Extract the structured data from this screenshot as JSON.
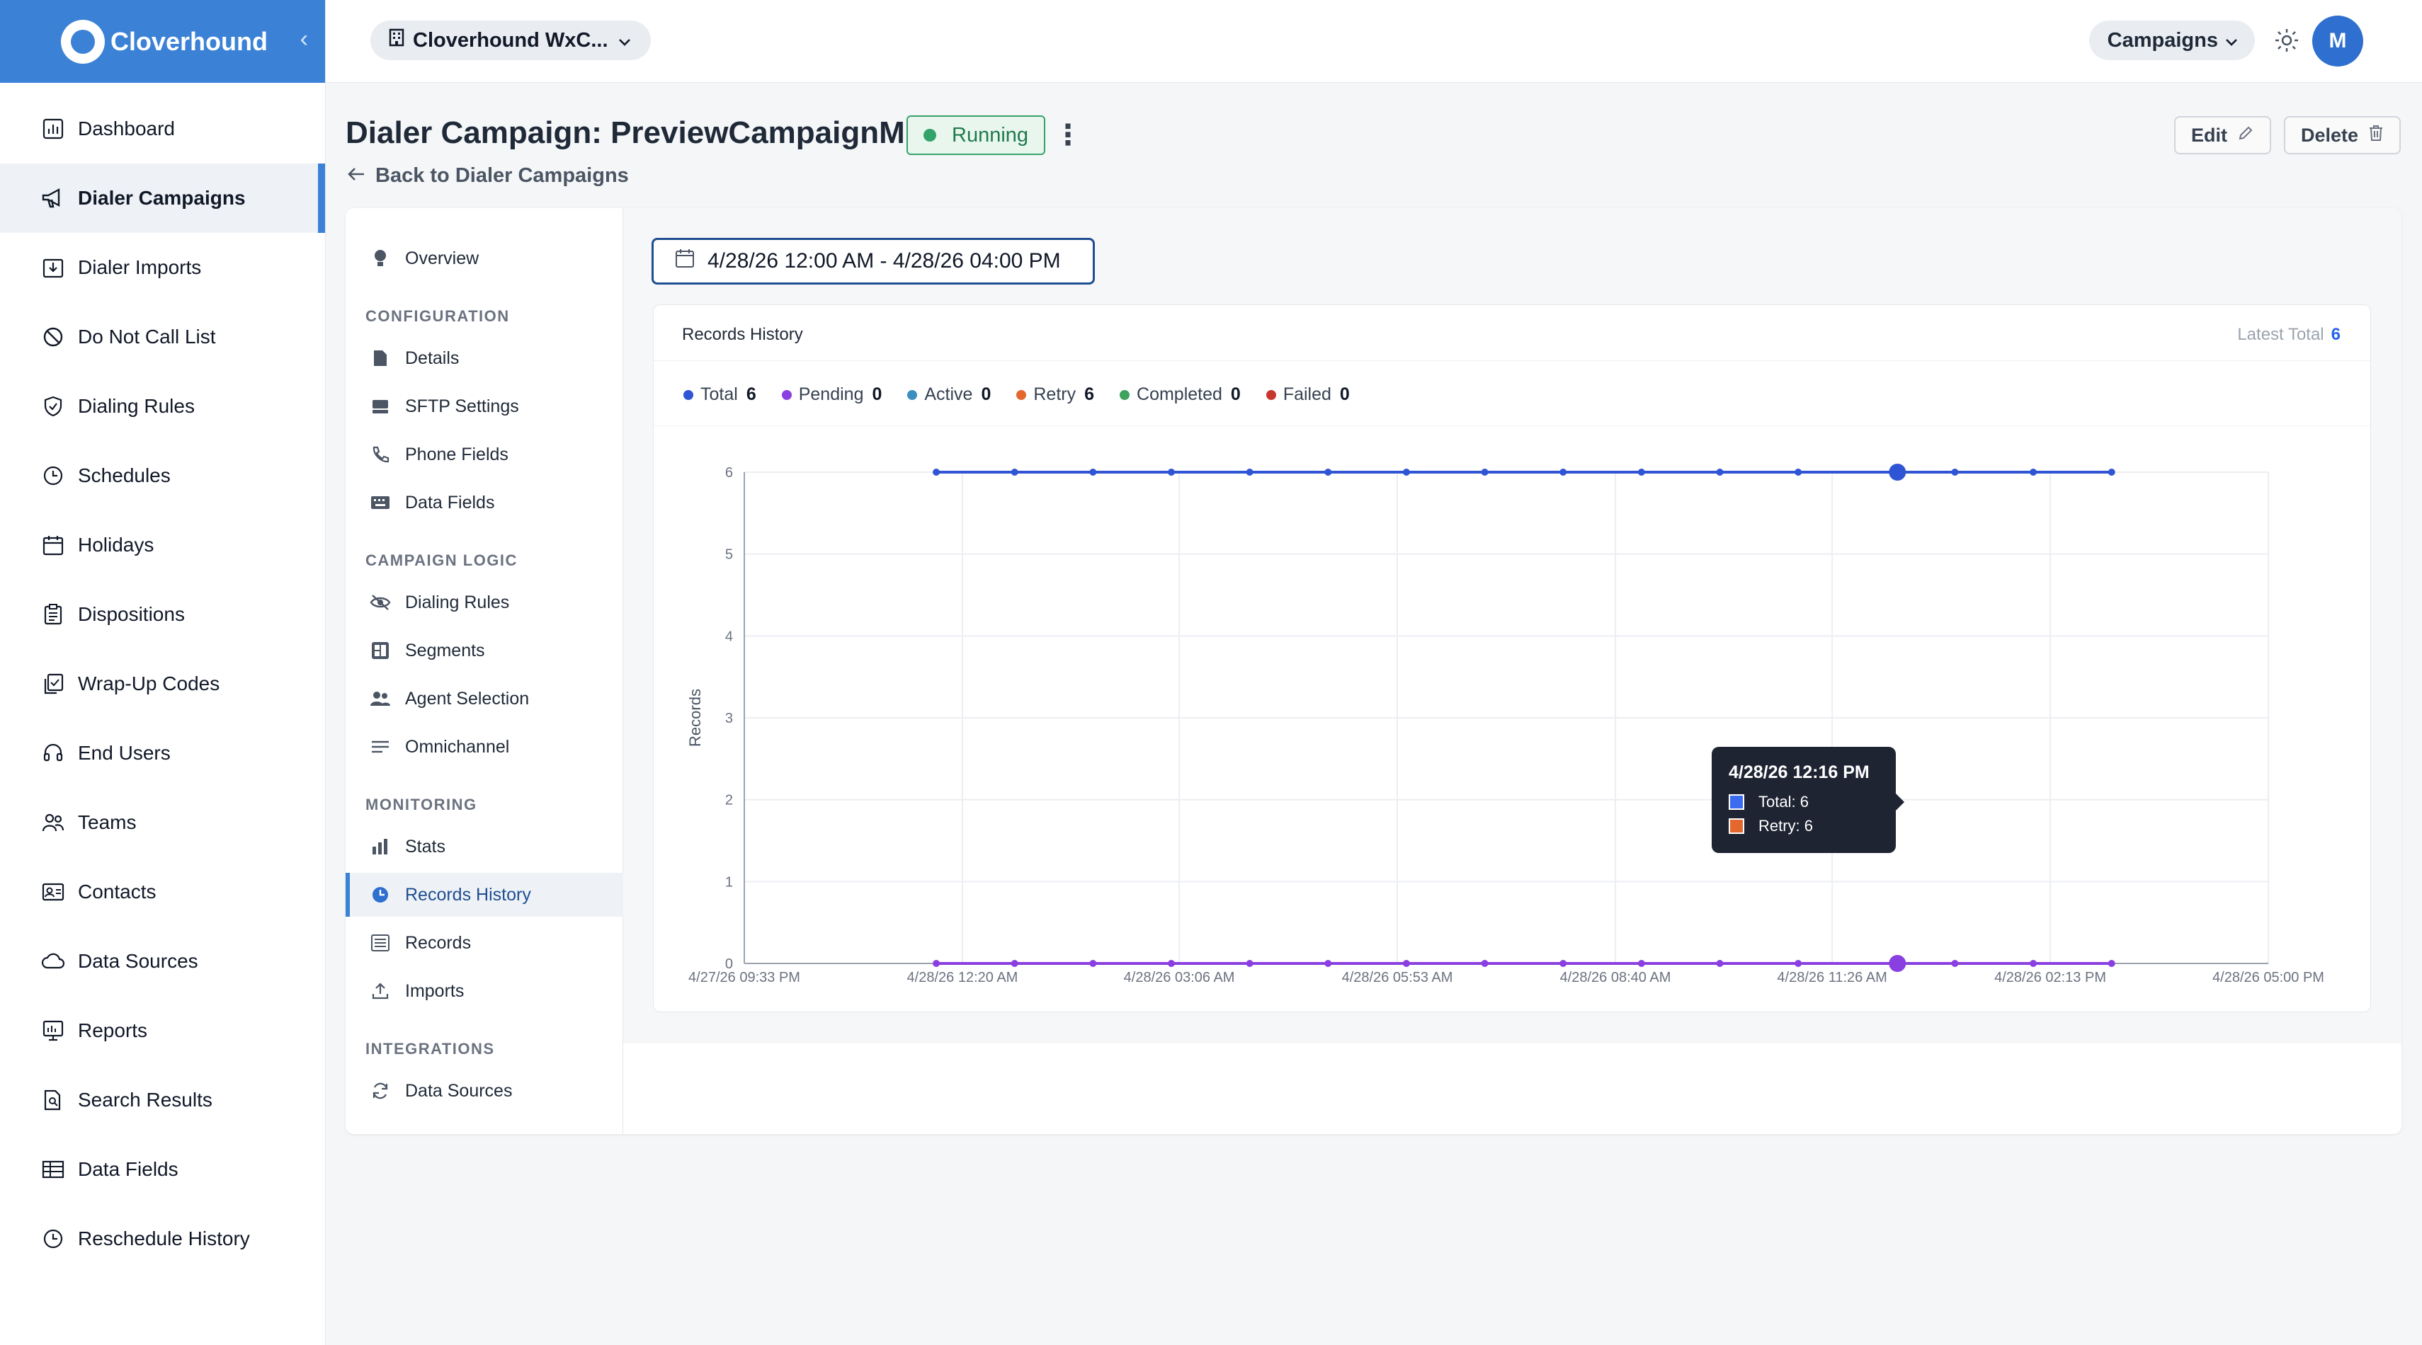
{
  "app": {
    "brand": "Cloverhound"
  },
  "sidebar": {
    "items": [
      {
        "label": "Dashboard",
        "icon": "dashboard-icon"
      },
      {
        "label": "Dialer Campaigns",
        "icon": "megaphone-icon",
        "active": true
      },
      {
        "label": "Dialer Imports",
        "icon": "import-icon"
      },
      {
        "label": "Do Not Call List",
        "icon": "ban-icon"
      },
      {
        "label": "Dialing Rules",
        "icon": "shield-icon"
      },
      {
        "label": "Schedules",
        "icon": "clock-icon"
      },
      {
        "label": "Holidays",
        "icon": "calendar-icon"
      },
      {
        "label": "Dispositions",
        "icon": "clipboard-icon"
      },
      {
        "label": "Wrap-Up Codes",
        "icon": "copy-icon"
      },
      {
        "label": "End Users",
        "icon": "headset-icon"
      },
      {
        "label": "Teams",
        "icon": "team-icon"
      },
      {
        "label": "Contacts",
        "icon": "contact-card-icon"
      },
      {
        "label": "Data Sources",
        "icon": "cloud-icon"
      },
      {
        "label": "Reports",
        "icon": "report-icon"
      },
      {
        "label": "Search Results",
        "icon": "document-search-icon"
      },
      {
        "label": "Data Fields",
        "icon": "table-icon"
      },
      {
        "label": "Reschedule History",
        "icon": "history-icon"
      }
    ]
  },
  "topbar": {
    "org_label": "Cloverhound WxC...",
    "menu_label": "Campaigns",
    "avatar_initial": "M"
  },
  "header": {
    "title": "Dialer Campaign: PreviewCampaignM",
    "status": "Running",
    "status_color": "#34a36b",
    "back_label": "Back to Dialer Campaigns",
    "edit_label": "Edit",
    "delete_label": "Delete"
  },
  "subnav": {
    "overview": "Overview",
    "configuration_heading": "CONFIGURATION",
    "details": "Details",
    "sftp": "SFTP Settings",
    "phone_fields": "Phone Fields",
    "data_fields": "Data Fields",
    "campaign_logic_heading": "CAMPAIGN LOGIC",
    "dialing_rules": "Dialing Rules",
    "segments": "Segments",
    "agent_selection": "Agent Selection",
    "omnichannel": "Omnichannel",
    "monitoring_heading": "MONITORING",
    "stats": "Stats",
    "records_history": "Records History",
    "records": "Records",
    "imports": "Imports",
    "integrations_heading": "INTEGRATIONS",
    "data_sources": "Data Sources"
  },
  "filters": {
    "date_range": "4/28/26 12:00 AM - 4/28/26 04:00 PM"
  },
  "records_history": {
    "title": "Records History",
    "latest_total_label": "Latest Total",
    "latest_total_value": "6",
    "legend": [
      {
        "label": "Total",
        "value": "6",
        "color": "#2f55d4"
      },
      {
        "label": "Pending",
        "value": "0",
        "color": "#8a3fe0"
      },
      {
        "label": "Active",
        "value": "0",
        "color": "#3a8fbf"
      },
      {
        "label": "Retry",
        "value": "6",
        "color": "#e4682e"
      },
      {
        "label": "Completed",
        "value": "0",
        "color": "#3da35d"
      },
      {
        "label": "Failed",
        "value": "0",
        "color": "#c8372d"
      }
    ],
    "tooltip": {
      "title": "4/28/26 12:16 PM",
      "rows": [
        "Total: 6",
        "Retry: 6"
      ],
      "colors": [
        "#3b6bf0",
        "#e4682e"
      ]
    }
  },
  "chart_data": {
    "type": "line",
    "ylabel": "Records",
    "ylim": [
      0,
      6
    ],
    "yticks": [
      0,
      1,
      2,
      3,
      4,
      5,
      6
    ],
    "xtick_labels": [
      "4/27/26 09:33 PM",
      "4/28/26 12:20 AM",
      "4/28/26 03:06 AM",
      "4/28/26 05:53 AM",
      "4/28/26 08:40 AM",
      "4/28/26 11:26 AM",
      "4/28/26 02:13 PM",
      "4/28/26 05:00 PM"
    ],
    "x_range": [
      "4/27/26 09:33 PM",
      "4/28/26 05:00 PM"
    ],
    "x": [
      "4/28/26 12:00 AM",
      "4/28/26 01:00 AM",
      "4/28/26 02:00 AM",
      "4/28/26 03:00 AM",
      "4/28/26 04:00 AM",
      "4/28/26 05:00 AM",
      "4/28/26 06:00 AM",
      "4/28/26 07:00 AM",
      "4/28/26 08:00 AM",
      "4/28/26 09:00 AM",
      "4/28/26 10:00 AM",
      "4/28/26 11:00 AM",
      "4/28/26 12:16 PM",
      "4/28/26 01:00 PM",
      "4/28/26 02:00 PM",
      "4/28/26 03:00 PM"
    ],
    "series": [
      {
        "name": "Total",
        "color": "#2f55d4",
        "values": [
          6,
          6,
          6,
          6,
          6,
          6,
          6,
          6,
          6,
          6,
          6,
          6,
          6,
          6,
          6,
          6
        ]
      },
      {
        "name": "Pending",
        "color": "#8a3fe0",
        "values": [
          0,
          0,
          0,
          0,
          0,
          0,
          0,
          0,
          0,
          0,
          0,
          0,
          0,
          0,
          0,
          0
        ]
      }
    ],
    "highlight_x": "4/28/26 12:16 PM",
    "grid": true
  }
}
